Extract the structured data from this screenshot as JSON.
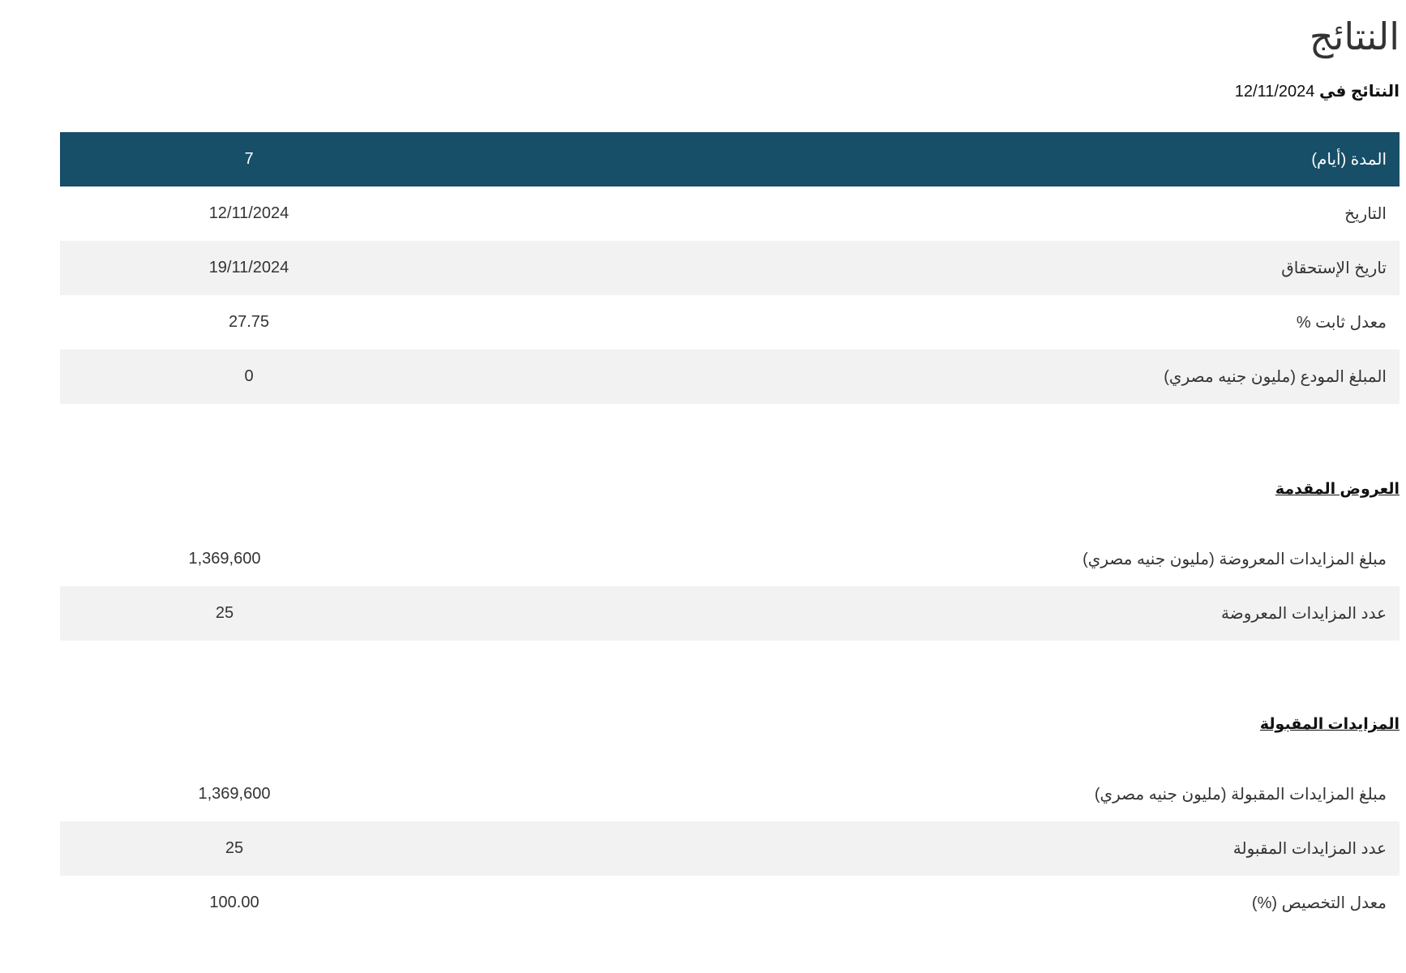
{
  "page": {
    "title": "النتائج",
    "date_label": "النتائج في",
    "date_value": "12/11/2024"
  },
  "main_table": {
    "header": {
      "label": "المدة (أيام)",
      "value": "7"
    },
    "rows": [
      {
        "label": "التاريخ",
        "value": "12/11/2024"
      },
      {
        "label": "تاريخ الإستحقاق",
        "value": "19/11/2024"
      },
      {
        "label": "معدل ثابت %",
        "value": "27.75"
      },
      {
        "label": "المبلغ المودع (مليون جنيه مصري)",
        "value": "0"
      }
    ]
  },
  "offers": {
    "heading": "العروض المقدمة",
    "rows": [
      {
        "label": "مبلغ المزايدات المعروضة (مليون جنيه مصري)",
        "value": "1,369,600"
      },
      {
        "label": "عدد المزايدات المعروضة",
        "value": "25"
      }
    ]
  },
  "accepted": {
    "heading": "المزايدات المقبولة",
    "rows": [
      {
        "label": "مبلغ المزايدات المقبولة (مليون جنيه مصري)",
        "value": "1,369,600"
      },
      {
        "label": "عدد المزايدات المقبولة",
        "value": "25"
      },
      {
        "label": "معدل التخصيص (%)",
        "value": "100.00"
      }
    ]
  },
  "colors": {
    "header_bg": "#174e68",
    "alt_row_bg": "#f2f2f3"
  }
}
